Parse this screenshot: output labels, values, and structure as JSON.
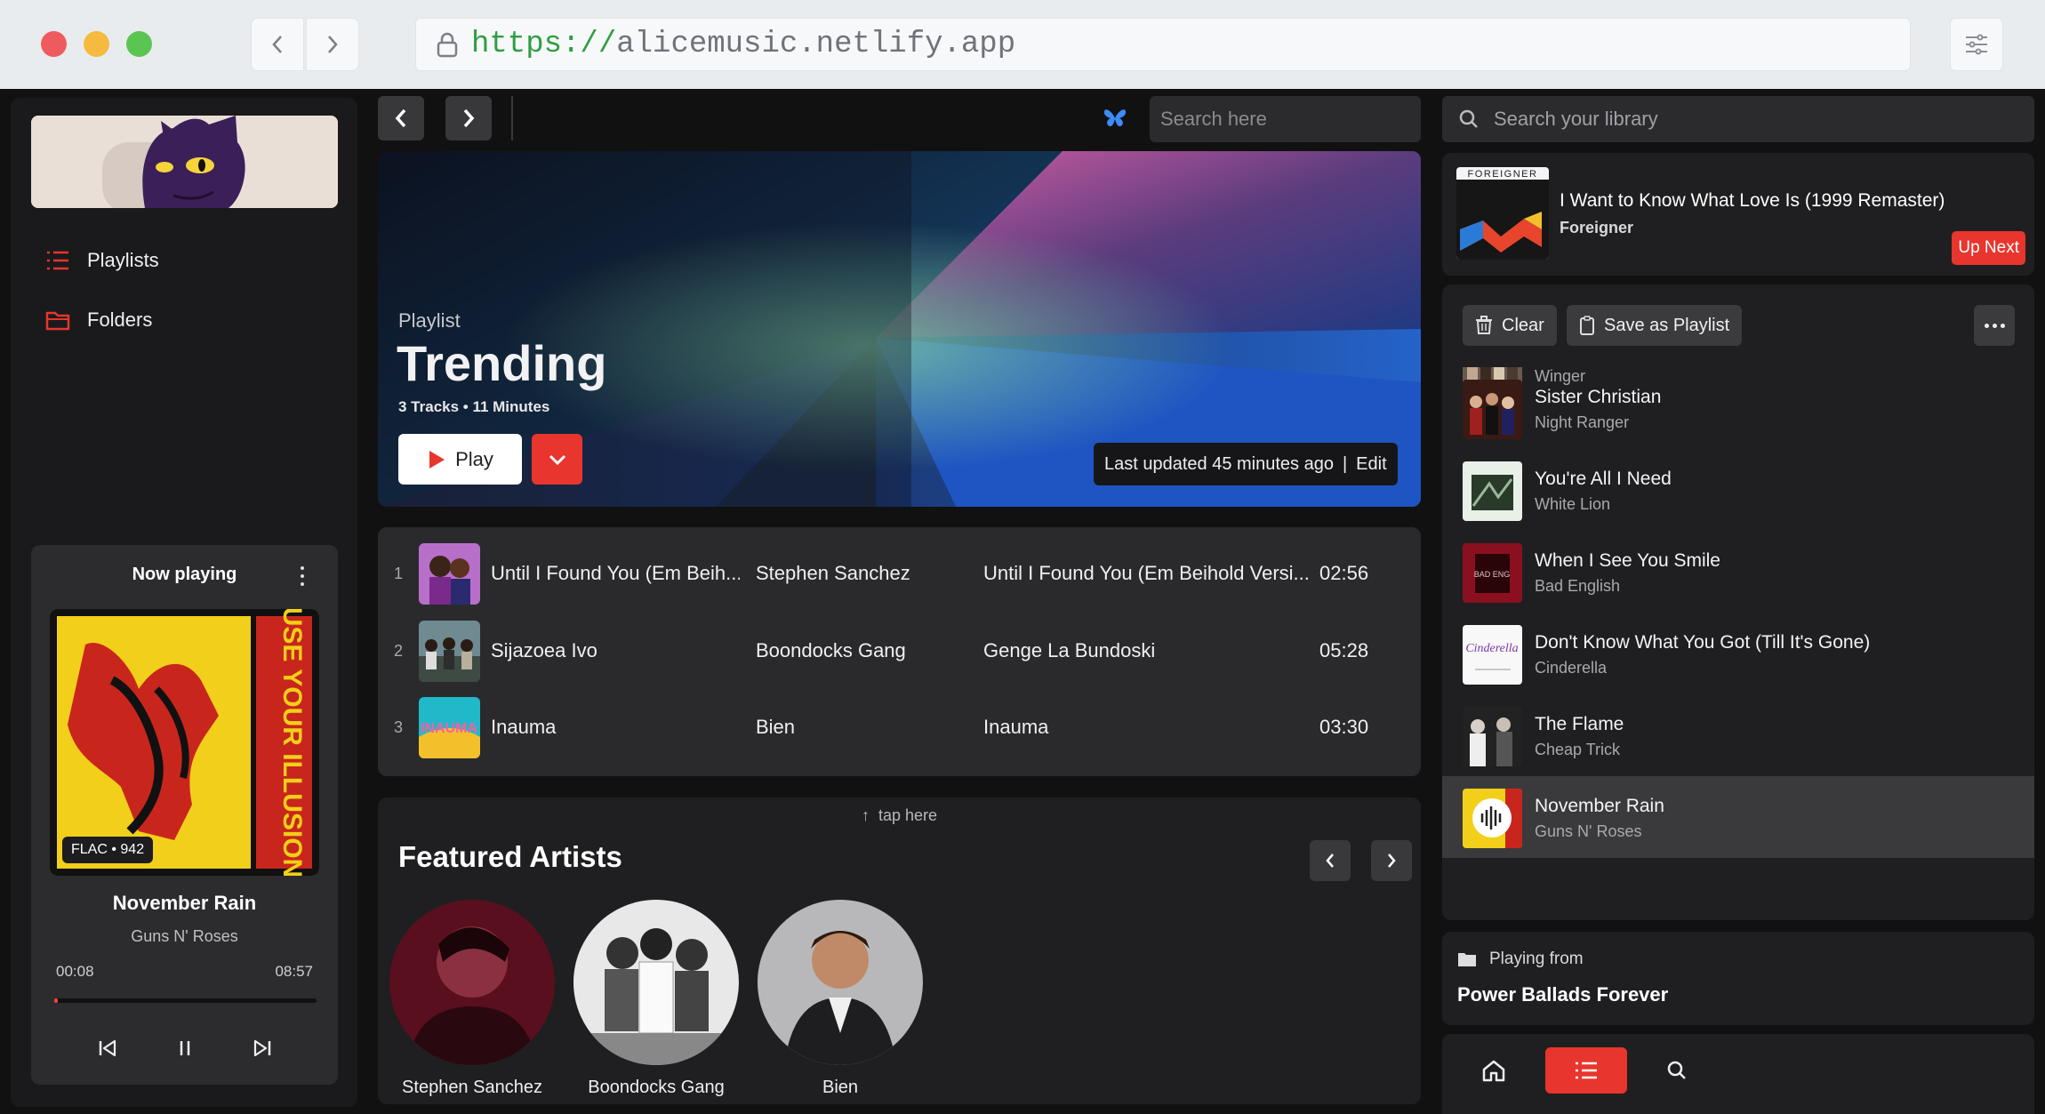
{
  "browser": {
    "url_scheme": "https://",
    "url_host": "alicemusic.netlify.app"
  },
  "sidebar": {
    "items": [
      {
        "label": "Playlists",
        "icon": "list-icon"
      },
      {
        "label": "Folders",
        "icon": "folder-icon"
      }
    ]
  },
  "now_playing": {
    "header": "Now playing",
    "badge": "FLAC • 942",
    "title": "November Rain",
    "artist": "Guns N' Roses",
    "current_time": "00:08",
    "duration": "08:57",
    "progress_fraction": 0.015
  },
  "search": {
    "placeholder": "Search here"
  },
  "hero": {
    "label": "Playlist",
    "title": "Trending",
    "meta": "3 Tracks • 11 Minutes",
    "play_label": "Play",
    "updated": "Last updated 45 minutes ago",
    "separator": "|",
    "edit_label": "Edit"
  },
  "tracks": [
    {
      "num": "1",
      "title": "Until I Found You (Em Beih...",
      "artist": "Stephen Sanchez",
      "album": "Until I Found You (Em Beihold Versi...",
      "duration": "02:56"
    },
    {
      "num": "2",
      "title": "Sijazoea Ivo",
      "artist": "Boondocks Gang",
      "album": "Genge La Bundoski",
      "duration": "05:28"
    },
    {
      "num": "3",
      "title": "Inauma",
      "artist": "Bien",
      "album": "Inauma",
      "duration": "03:30"
    }
  ],
  "featured": {
    "tap_here": "tap here",
    "title": "Featured Artists",
    "artists": [
      {
        "name": "Stephen Sanchez"
      },
      {
        "name": "Boondocks Gang"
      },
      {
        "name": "Bien"
      }
    ]
  },
  "library": {
    "search_placeholder": "Search your library"
  },
  "up_next": {
    "cover_text": "FOREIGNER",
    "title": "I Want to Know What Love Is (1999 Remaster)",
    "artist": "Foreigner",
    "badge": "Up Next"
  },
  "queue": {
    "clear_label": "Clear",
    "save_label": "Save as Playlist",
    "items": [
      {
        "title": "",
        "artist": "Winger"
      },
      {
        "title": "Sister Christian",
        "artist": "Night Ranger"
      },
      {
        "title": "You're All I Need",
        "artist": "White Lion"
      },
      {
        "title": "When I See You Smile",
        "artist": "Bad English"
      },
      {
        "title": "Don't Know What You Got (Till It's Gone)",
        "artist": "Cinderella"
      },
      {
        "title": "The Flame",
        "artist": "Cheap Trick"
      },
      {
        "title": "November Rain",
        "artist": "Guns N' Roses"
      }
    ]
  },
  "playing_from": {
    "label": "Playing from",
    "name": "Power Ballads Forever"
  },
  "colors": {
    "accent": "#e8352d",
    "background": "#111112",
    "panel": "#1f1f21"
  }
}
